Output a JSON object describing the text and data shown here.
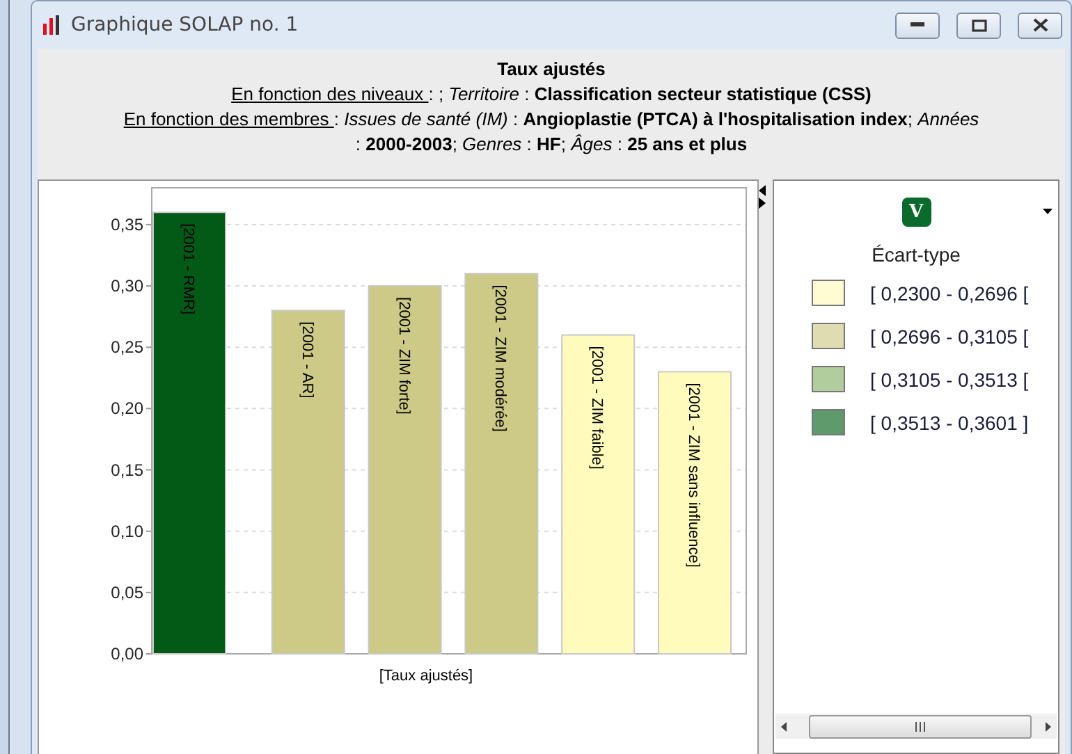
{
  "window": {
    "title": "Graphique SOLAP no. 1"
  },
  "header": {
    "title": "Taux ajustés",
    "lines": [
      [
        {
          "text": "En fonction des niveaux ",
          "kind": "underline"
        },
        {
          "text": " : ; ",
          "kind": "plain"
        },
        {
          "text": "Territoire",
          "kind": "italic"
        },
        {
          "text": " : ",
          "kind": "plain"
        },
        {
          "text": "Classification secteur statistique (CSS)",
          "kind": "bold"
        }
      ],
      [
        {
          "text": "En fonction des membres ",
          "kind": "underline"
        },
        {
          "text": " : ",
          "kind": "plain"
        },
        {
          "text": "Issues de santé (IM)",
          "kind": "italic"
        },
        {
          "text": " : ",
          "kind": "plain"
        },
        {
          "text": "Angioplastie (PTCA) à l'hospitalisation index",
          "kind": "bold"
        },
        {
          "text": "; ",
          "kind": "plain"
        },
        {
          "text": "Années",
          "kind": "italic"
        }
      ],
      [
        {
          "text": " : ",
          "kind": "plain"
        },
        {
          "text": "2000-2003",
          "kind": "bold"
        },
        {
          "text": "; ",
          "kind": "plain"
        },
        {
          "text": "Genres",
          "kind": "italic"
        },
        {
          "text": " : ",
          "kind": "plain"
        },
        {
          "text": "HF",
          "kind": "bold"
        },
        {
          "text": "; ",
          "kind": "plain"
        },
        {
          "text": "Âges",
          "kind": "italic"
        },
        {
          "text": " : ",
          "kind": "plain"
        },
        {
          "text": "25 ans et plus",
          "kind": "bold"
        }
      ]
    ]
  },
  "chart_data": {
    "type": "bar",
    "xlabel": "[Taux ajustés]",
    "categories": [
      "[2001 - RMR]",
      "[2001 - AR]",
      "[2001 - ZIM forte]",
      "[2001 - ZIM modérée]",
      "[2001 - ZIM faible]",
      "[2001 - ZIM sans influence]"
    ],
    "series": [
      {
        "color": "#035a16",
        "values": [
          0.36,
          null,
          null,
          null,
          null,
          null
        ]
      },
      {
        "color": "#cdc986",
        "values": [
          null,
          0.28,
          0.3,
          0.31,
          null,
          null
        ]
      },
      {
        "color": "#fffbbd",
        "values": [
          null,
          null,
          null,
          null,
          0.26,
          0.23
        ]
      }
    ],
    "ylim": [
      0,
      0.38
    ],
    "yticks": [
      {
        "value": 0,
        "label": "0,00"
      },
      {
        "value": 0.05,
        "label": "0,05"
      },
      {
        "value": 0.1,
        "label": "0,10"
      },
      {
        "value": 0.15,
        "label": "0,15"
      },
      {
        "value": 0.2,
        "label": "0,20"
      },
      {
        "value": 0.25,
        "label": "0,25"
      },
      {
        "value": 0.3,
        "label": "0,30"
      },
      {
        "value": 0.35,
        "label": "0,35"
      }
    ],
    "grid": true
  },
  "legend": {
    "badge": "V",
    "title": "Écart-type",
    "items": [
      {
        "label": "[ 0,2300 - 0,2696 [",
        "color": "#fffcd4"
      },
      {
        "label": "[ 0,2696 - 0,3105 [",
        "color": "#e0dcb1"
      },
      {
        "label": "[ 0,3105 - 0,3513 [",
        "color": "#b2cd9d"
      },
      {
        "label": "[ 0,3513 - 0,3601 ]",
        "color": "#5f9a6d"
      }
    ]
  }
}
